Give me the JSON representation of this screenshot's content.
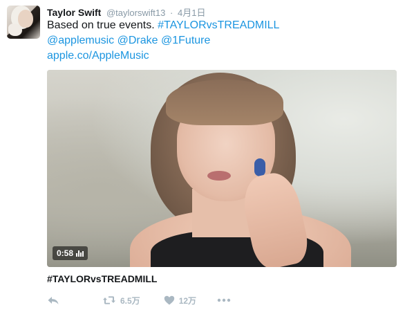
{
  "tweet": {
    "author": {
      "name": "Taylor Swift",
      "handle": "@taylorswift13"
    },
    "separator": "·",
    "timestamp": "4月1日",
    "text": {
      "line1_plain": "Based on true events. ",
      "hashtag": "#TAYLORvsTREADMILL",
      "mention1": "@applemusic",
      "mention2": "@Drake",
      "mention3": "@1Future",
      "link": "apple.co/AppleMusic"
    },
    "media": {
      "duration": "0:58"
    },
    "card_title": "#TAYLORvsTREADMILL",
    "actions": {
      "retweet_count": "6.5万",
      "like_count": "12万"
    }
  },
  "colors": {
    "link": "#1b95e0",
    "muted": "#8899a6",
    "action_icon": "#aab8c2"
  },
  "icons": [
    "reply-icon",
    "retweet-icon",
    "heart-icon",
    "more-icon",
    "audio-bars-icon"
  ]
}
